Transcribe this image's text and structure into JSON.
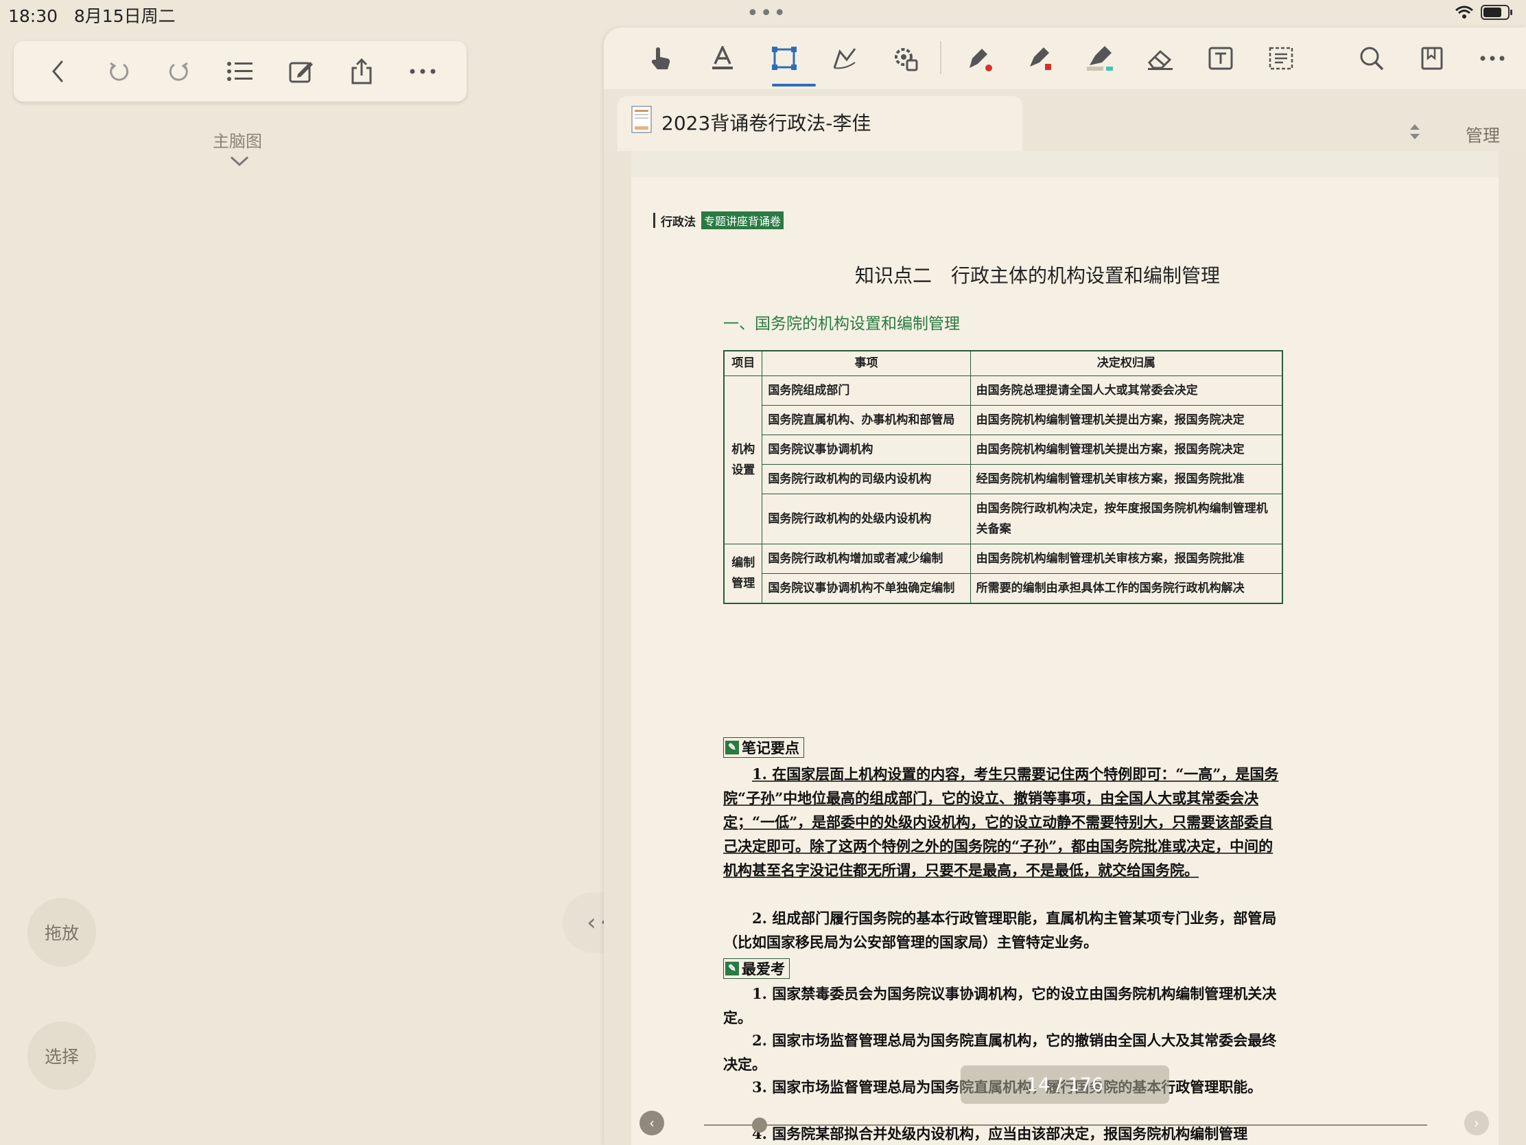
{
  "status": {
    "time": "18:30",
    "date": "8月15日周二"
  },
  "left": {
    "mindmap_label": "主脑图",
    "drag_button": "拖放",
    "select_button": "选择",
    "toolbar_icons": [
      "back-icon",
      "undo-icon",
      "redo-icon",
      "list-icon",
      "edit-icon",
      "share-icon",
      "more-icon"
    ]
  },
  "doc": {
    "tab_title": "2023背诵卷行政法-李佳",
    "manage_label": "管理",
    "header_label": "行政法",
    "header_tag": "专题讲座背诵卷",
    "kp_title": "知识点二　行政主体的机构设置和编制管理",
    "section_title": "一、国务院的机构设置和编制管理",
    "table": {
      "headers": [
        "项目",
        "事项",
        "决定权归属"
      ],
      "group1": "机构设置",
      "group2": "编制管理",
      "rows": [
        [
          "国务院组成部门",
          "由国务院总理提请全国人大或其常委会决定"
        ],
        [
          "国务院直属机构、办事机构和部管局",
          "由国务院机构编制管理机关提出方案，报国务院决定"
        ],
        [
          "国务院议事协调机构",
          "由国务院机构编制管理机关提出方案，报国务院决定"
        ],
        [
          "国务院行政机构的司级内设机构",
          "经国务院机构编制管理机关审核方案，报国务院批准"
        ],
        [
          "国务院行政机构的处级内设机构",
          "由国务院行政机构决定，按年度报国务院机构编制管理机关备案"
        ],
        [
          "国务院行政机构增加或者减少编制",
          "由国务院机构编制管理机关审核方案，报国务院批准"
        ],
        [
          "国务院议事协调机构不单独确定编制",
          "所需要的编制由承担具体工作的国务院行政机构解决"
        ]
      ]
    },
    "notes_title": "笔记要点",
    "note1": "1. 在国家层面上机构设置的内容，考生只需要记住两个特例即可：“一高”，是国务院“子孙”中地位最高的组成部门，它的设立、撤销等事项，由全国人大或其常委会决定；“一低”，是部委中的处级内设机构，它的设立动静不需要特别大，只需要该部委自己决定即可。除了这两个特例之外的国务院的“子孙”，都由国务院批准或决定，中间的机构甚至名字没记住都无所谓，只要不是最高，不是最低，就交给国务院。",
    "note2": "2. 组成部门履行国务院的基本行政管理职能，直属机构主管某项专门业务，部管局（比如国家移民局为公安部管理的国家局）主管特定业务。",
    "exam_title": "最爱考",
    "exam1": "1. 国家禁毒委员会为国务院议事协调机构，它的设立由国务院机构编制管理机关决定。",
    "exam2": "2. 国家市场监督管理总局为国务院直属机构，它的撤销由全国人大及其常委会最终决定。",
    "exam3": "3. 国家市场监督管理总局为国务院直属机构，履行国务院的基本行政管理职能。",
    "exam4": "4. 国务院某部拟合并处级内设机构，应当由该部决定，报国务院机构编制管理",
    "page_indicator": "14 / 176"
  },
  "colors": {
    "accent": "#2f6db8",
    "green": "#2a7a43",
    "paper": "#f5f0e3"
  }
}
